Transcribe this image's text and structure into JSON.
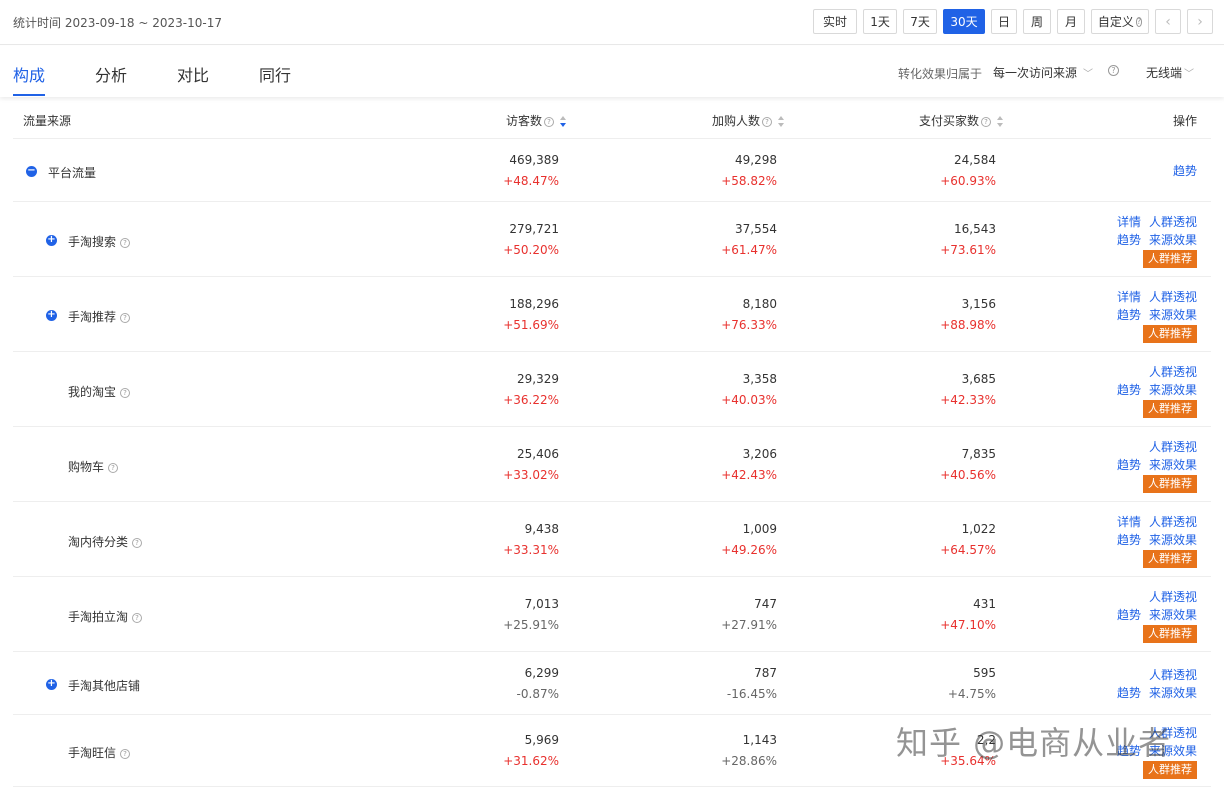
{
  "header": {
    "date_range": "统计时间 2023-09-18 ~ 2023-10-17",
    "periods": [
      "实时",
      "1天",
      "7天",
      "30天",
      "日",
      "周",
      "月"
    ],
    "active_period": "30天",
    "custom_label": "自定义",
    "prev_icon": "chevron-left-icon",
    "next_icon": "chevron-right-icon"
  },
  "tabs": {
    "items": [
      "构成",
      "分析",
      "对比",
      "同行"
    ],
    "active": "构成",
    "attribution_label": "转化效果归属于",
    "attribution_value": "每一次访问来源",
    "device_value": "无线端"
  },
  "table": {
    "columns": {
      "source": "流量来源",
      "visitors": "访客数",
      "cart": "加购人数",
      "buyers": "支付买家数",
      "actions": "操作"
    },
    "sort_column": "访客数",
    "rows": [
      {
        "name": "平台流量",
        "level": 0,
        "expand": "minus",
        "help": false,
        "visitors": "469,389",
        "visitors_change": "+48.47%",
        "cart": "49,298",
        "cart_change": "+58.82%",
        "buyers": "24,584",
        "buyers_change": "+60.93%",
        "ops": [
          [
            "趋势"
          ]
        ],
        "highlight": null
      },
      {
        "name": "手淘搜索",
        "level": 1,
        "expand": "plus",
        "help": true,
        "visitors": "279,721",
        "visitors_change": "+50.20%",
        "cart": "37,554",
        "cart_change": "+61.47%",
        "buyers": "16,543",
        "buyers_change": "+73.61%",
        "ops": [
          [
            "详情",
            "人群透视"
          ],
          [
            "趋势",
            "来源效果"
          ]
        ],
        "highlight": "人群推荐"
      },
      {
        "name": "手淘推荐",
        "level": 1,
        "expand": "plus",
        "help": true,
        "visitors": "188,296",
        "visitors_change": "+51.69%",
        "cart": "8,180",
        "cart_change": "+76.33%",
        "buyers": "3,156",
        "buyers_change": "+88.98%",
        "ops": [
          [
            "详情",
            "人群透视"
          ],
          [
            "趋势",
            "来源效果"
          ]
        ],
        "highlight": "人群推荐"
      },
      {
        "name": "我的淘宝",
        "level": 1,
        "expand": null,
        "help": true,
        "visitors": "29,329",
        "visitors_change": "+36.22%",
        "cart": "3,358",
        "cart_change": "+40.03%",
        "buyers": "3,685",
        "buyers_change": "+42.33%",
        "ops": [
          [
            "人群透视"
          ],
          [
            "趋势",
            "来源效果"
          ]
        ],
        "highlight": "人群推荐"
      },
      {
        "name": "购物车",
        "level": 1,
        "expand": null,
        "help": true,
        "visitors": "25,406",
        "visitors_change": "+33.02%",
        "cart": "3,206",
        "cart_change": "+42.43%",
        "buyers": "7,835",
        "buyers_change": "+40.56%",
        "ops": [
          [
            "人群透视"
          ],
          [
            "趋势",
            "来源效果"
          ]
        ],
        "highlight": "人群推荐"
      },
      {
        "name": "淘内待分类",
        "level": 1,
        "expand": null,
        "help": true,
        "visitors": "9,438",
        "visitors_change": "+33.31%",
        "cart": "1,009",
        "cart_change": "+49.26%",
        "buyers": "1,022",
        "buyers_change": "+64.57%",
        "ops": [
          [
            "详情",
            "人群透视"
          ],
          [
            "趋势",
            "来源效果"
          ]
        ],
        "highlight": "人群推荐"
      },
      {
        "name": "手淘拍立淘",
        "level": 1,
        "expand": null,
        "help": true,
        "visitors": "7,013",
        "visitors_change": "+25.91%",
        "cart": "747",
        "cart_change": "+27.91%",
        "buyers": "431",
        "buyers_change": "+47.10%",
        "ops": [
          [
            "人群透视"
          ],
          [
            "趋势",
            "来源效果"
          ]
        ],
        "highlight": "人群推荐"
      },
      {
        "name": "手淘其他店铺",
        "level": 1,
        "expand": "plus",
        "help": false,
        "visitors": "6,299",
        "visitors_change": "-0.87%",
        "cart": "787",
        "cart_change": "-16.45%",
        "buyers": "595",
        "buyers_change": "+4.75%",
        "ops": [
          [
            "人群透视"
          ],
          [
            "趋势",
            "来源效果"
          ]
        ],
        "highlight": null
      },
      {
        "name": "手淘旺信",
        "level": 1,
        "expand": null,
        "help": true,
        "visitors": "5,969",
        "visitors_change": "+31.62%",
        "cart": "1,143",
        "cart_change": "+28.86%",
        "buyers": "2,2",
        "buyers_change": "+35.64%",
        "ops": [
          [
            "人群透视"
          ],
          [
            "趋势",
            "来源效果"
          ]
        ],
        "highlight": "人群推荐"
      }
    ]
  },
  "watermark": "知乎 @电商从业者",
  "colors": {
    "accent": "#2062e6",
    "positive": "#e8312e",
    "neutral": "#666666",
    "highlight": "#e8731a"
  }
}
